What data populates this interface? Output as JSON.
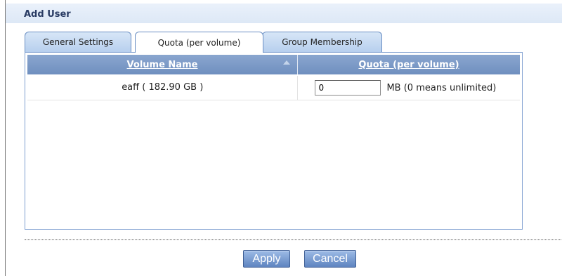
{
  "window": {
    "title": "Add User"
  },
  "tabs": [
    {
      "label": "General Settings",
      "active": false
    },
    {
      "label": "Quota (per volume)",
      "active": true
    },
    {
      "label": "Group Membership",
      "active": false
    }
  ],
  "table": {
    "columns": [
      "Volume Name",
      "Quota (per volume)"
    ],
    "sorted_column_icon": "sort-ascending-icon",
    "rows": [
      {
        "volume": "eaff ( 182.90 GB )",
        "quota_value": "0",
        "unit": "MB (0 means unlimited)"
      }
    ]
  },
  "buttons": {
    "apply": "Apply",
    "cancel": "Cancel"
  },
  "colors": {
    "header_bg": "#7b98c6",
    "tab_bg": "#c6daf2",
    "button_bg": "#6f93cc",
    "title_color": "#2a3c64"
  }
}
